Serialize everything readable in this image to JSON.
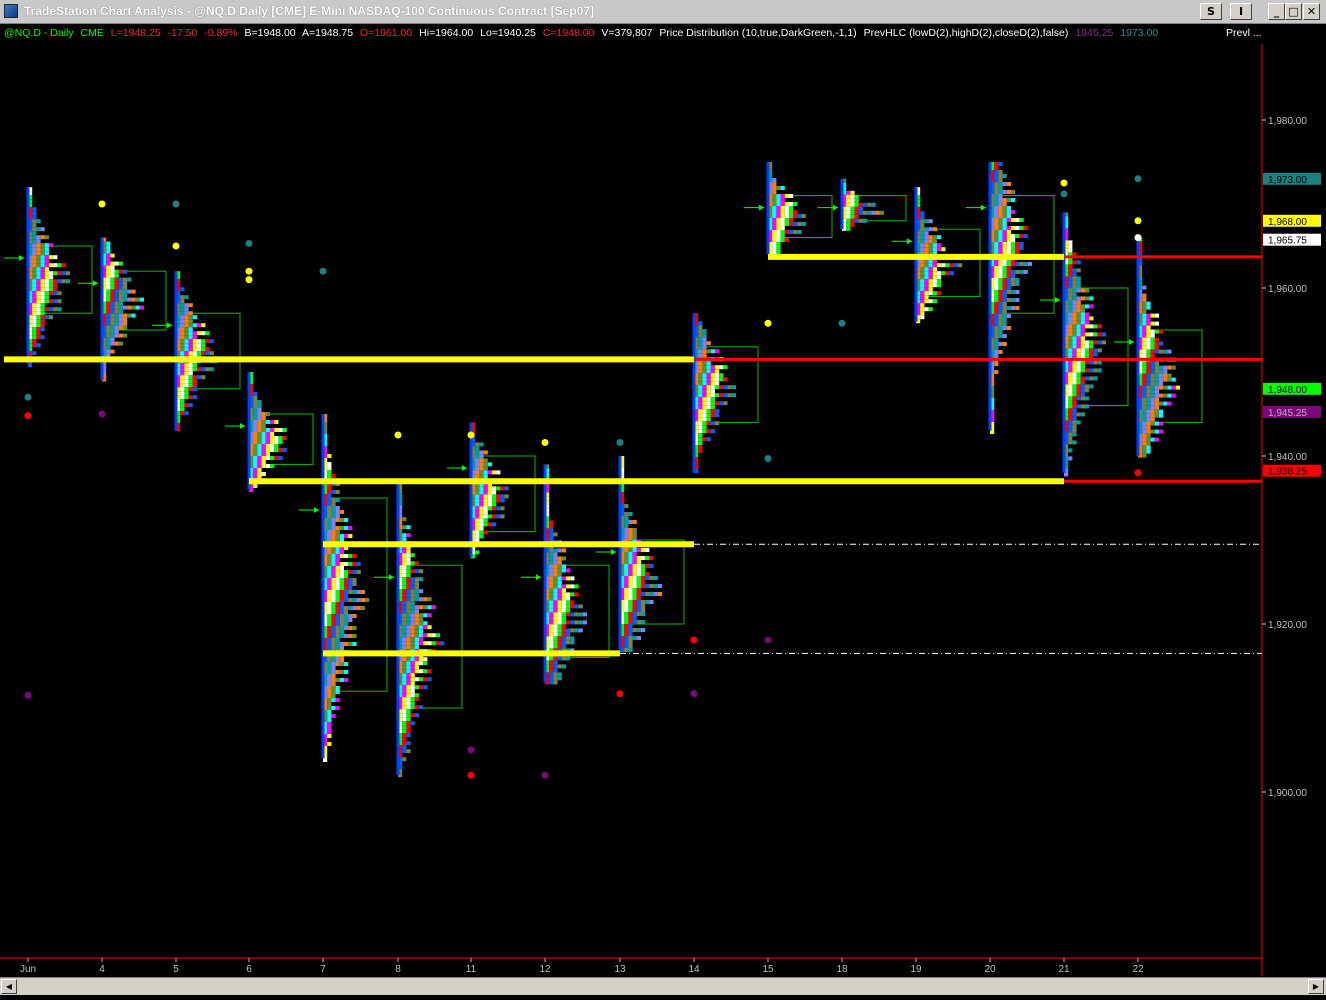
{
  "window": {
    "title": "TradeStation Chart Analysis - @NQ.D  Daily  [CME] E-Mini NASDAQ-100 Continuous Contract [Sep07]",
    "btn_s": "S",
    "btn_i": "I",
    "btn_min": "_",
    "btn_max": "□",
    "btn_close": "✕"
  },
  "status": {
    "symbol": "@NQ.D - Daily",
    "exchange": "CME",
    "last": "L=1948.25",
    "change": "-17.50",
    "pct": "-0.89%",
    "bid": "B=1948.00",
    "ask": "A=1948.75",
    "open": "O=1961.00",
    "high": "Hi=1964.00",
    "low": "Lo=1940.25",
    "close": "C=1948.00",
    "volume": "V=379,807",
    "ind1": "Price Distribution (10,true,DarkGreen,-1,1)",
    "ind2": "PrevHLC (lowD(2),highD(2),closeD(2),false)",
    "ind2_v1": "1945.25",
    "ind2_v2": "1973.00",
    "ind3": "Prevl ..."
  },
  "colors": {
    "yellow": "#ffff00",
    "red": "#ff0000",
    "green_text": "#00ff00",
    "red_text": "#ff2020",
    "white": "#ffffff",
    "teal": "#1a8080",
    "purple": "#7a0a7a"
  },
  "chart_data": {
    "type": "price-distribution-daily",
    "y_range": [
      1890,
      1990
    ],
    "y_ticks": [
      "1,980.00",
      "1,960.00",
      "1,940.00",
      "1,920.00",
      "1,900.00"
    ],
    "x_labels": [
      "Jun",
      "4",
      "5",
      "6",
      "7",
      "8",
      "11",
      "12",
      "13",
      "14",
      "15",
      "18",
      "19",
      "20",
      "21",
      "22"
    ],
    "price_flags": [
      {
        "label": "1,973.00",
        "price": 1973.0,
        "bg": "#1a8080",
        "fg": "#000000"
      },
      {
        "label": "1,968.00",
        "price": 1968.0,
        "bg": "#ffff00",
        "fg": "#000000"
      },
      {
        "label": "1,965.75",
        "price": 1965.75,
        "bg": "#ffffff",
        "fg": "#000000"
      },
      {
        "label": "1,948.00",
        "price": 1948.0,
        "bg": "#00ff00",
        "fg": "#000000"
      },
      {
        "label": "1,945.25",
        "price": 1945.25,
        "bg": "#7a0a7a",
        "fg": "#c8a0c8"
      },
      {
        "label": "1,938.25",
        "price": 1938.25,
        "bg": "#ff0000",
        "fg": "#000000"
      }
    ],
    "bars": [
      {
        "day": "Jun",
        "high": 1972,
        "low": 1951,
        "vah": 1965,
        "val": 1957
      },
      {
        "day": "4",
        "high": 1966,
        "low": 1949,
        "vah": 1962,
        "val": 1955
      },
      {
        "day": "5",
        "high": 1962,
        "low": 1943,
        "vah": 1957,
        "val": 1948
      },
      {
        "day": "6",
        "high": 1950,
        "low": 1936,
        "vah": 1945,
        "val": 1939
      },
      {
        "day": "7",
        "high": 1945,
        "low": 1904,
        "vah": 1935,
        "val": 1912
      },
      {
        "day": "8",
        "high": 1937,
        "low": 1902,
        "vah": 1927,
        "val": 1910
      },
      {
        "day": "11",
        "high": 1944,
        "low": 1928,
        "vah": 1940,
        "val": 1931
      },
      {
        "day": "12",
        "high": 1939,
        "low": 1913,
        "vah": 1927,
        "val": 1916
      },
      {
        "day": "13",
        "high": 1940,
        "low": 1917,
        "vah": 1930,
        "val": 1920
      },
      {
        "day": "14",
        "high": 1957,
        "low": 1938,
        "vah": 1953,
        "val": 1944
      },
      {
        "day": "15",
        "high": 1975,
        "low": 1964,
        "vah": 1971,
        "val": 1966
      },
      {
        "day": "18",
        "high": 1973,
        "low": 1967,
        "vah": 1971,
        "val": 1968
      },
      {
        "day": "19",
        "high": 1972,
        "low": 1956,
        "vah": 1967,
        "val": 1959
      },
      {
        "day": "20",
        "high": 1975,
        "low": 1943,
        "vah": 1971,
        "val": 1957
      },
      {
        "day": "21",
        "high": 1969,
        "low": 1938,
        "vah": 1960,
        "val": 1946
      },
      {
        "day": "22",
        "high": 1966,
        "low": 1940,
        "vah": 1955,
        "val": 1944
      }
    ],
    "yellow_levels": [
      {
        "price": 1951.5,
        "from": "Jun",
        "to": "14"
      },
      {
        "price": 1937.0,
        "from": "6",
        "to": "21"
      },
      {
        "price": 1929.5,
        "from": "7",
        "to": "14"
      },
      {
        "price": 1916.5,
        "from": "7",
        "to": "13"
      },
      {
        "price": 1963.7,
        "from": "15",
        "to": "21"
      }
    ],
    "red_levels": [
      {
        "price": 1951.5,
        "from": "14",
        "to": "end"
      },
      {
        "price": 1963.7,
        "from": "21",
        "to": "end"
      },
      {
        "price": 1937.0,
        "from": "21",
        "to": "end"
      }
    ],
    "dashed_levels": [
      {
        "price": 1929.5,
        "from": "14",
        "to": "end"
      },
      {
        "price": 1916.5,
        "from": "13",
        "to": "end"
      }
    ],
    "dots": [
      {
        "day": "Jun",
        "price": 1947,
        "color": "#1a8080"
      },
      {
        "day": "Jun",
        "price": 1944.8,
        "color": "#ff0000"
      },
      {
        "day": "Jun",
        "price": 1911.5,
        "color": "#7a0a7a"
      },
      {
        "day": "4",
        "price": 1970,
        "color": "#ffff00"
      },
      {
        "day": "4",
        "price": 1945,
        "color": "#7a0a7a"
      },
      {
        "day": "5",
        "price": 1970,
        "color": "#1a8080"
      },
      {
        "day": "5",
        "price": 1965,
        "color": "#ffff00"
      },
      {
        "day": "6",
        "price": 1965.3,
        "color": "#1a8080"
      },
      {
        "day": "6",
        "price": 1962,
        "color": "#ffff00"
      },
      {
        "day": "6",
        "price": 1961,
        "color": "#ffff00"
      },
      {
        "day": "7",
        "price": 1962,
        "color": "#1a8080"
      },
      {
        "day": "8",
        "price": 1942.5,
        "color": "#ffff00"
      },
      {
        "day": "11",
        "price": 1942.5,
        "color": "#ffff00"
      },
      {
        "day": "11",
        "price": 1905,
        "color": "#7a0a7a"
      },
      {
        "day": "11",
        "price": 1902,
        "color": "#ff0000"
      },
      {
        "day": "12",
        "price": 1941.6,
        "color": "#ffff00"
      },
      {
        "day": "12",
        "price": 1902,
        "color": "#7a0a7a"
      },
      {
        "day": "13",
        "price": 1941.6,
        "color": "#1a8080"
      },
      {
        "day": "13",
        "price": 1911.7,
        "color": "#ff0000"
      },
      {
        "day": "14",
        "price": 1918.1,
        "color": "#ff0000"
      },
      {
        "day": "14",
        "price": 1911.7,
        "color": "#7a0a7a"
      },
      {
        "day": "15",
        "price": 1955.8,
        "color": "#ffff00"
      },
      {
        "day": "15",
        "price": 1939.7,
        "color": "#1a8080"
      },
      {
        "day": "15",
        "price": 1918.1,
        "color": "#7a0a7a"
      },
      {
        "day": "18",
        "price": 1955.8,
        "color": "#1a8080"
      },
      {
        "day": "21",
        "price": 1972.5,
        "color": "#ffff00"
      },
      {
        "day": "21",
        "price": 1971.2,
        "color": "#1a8080"
      },
      {
        "day": "22",
        "price": 1973,
        "color": "#1a8080"
      },
      {
        "day": "22",
        "price": 1968,
        "color": "#ffff00"
      },
      {
        "day": "22",
        "price": 1966,
        "color": "#ffffff"
      },
      {
        "day": "22",
        "price": 1938,
        "color": "#ff0000"
      }
    ]
  }
}
